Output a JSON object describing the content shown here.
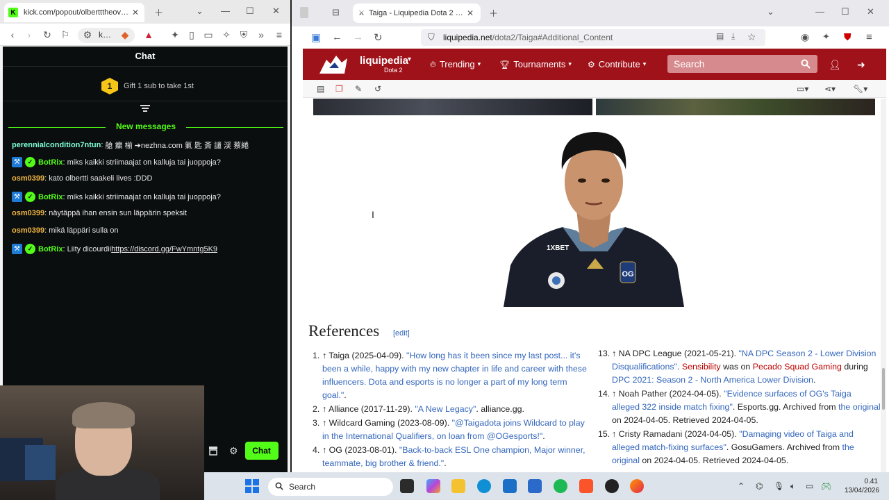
{
  "left_browser": {
    "tab_title": "kick.com/popout/olbertttheovers",
    "url_short": "k…",
    "chat": {
      "title": "Chat",
      "gift_number": "1",
      "gift_text": "Gift 1 sub to take 1st",
      "new_messages_label": "New messages",
      "messages": [
        {
          "user": "perennialcondition7ntun",
          "text": "艙 瘺 椾 ➔nezhna.com 氭 匙 斎 譴 渓 蔡綣",
          "color": "#7fffd4",
          "badges": []
        },
        {
          "user": "BotRix",
          "text": "miks kaikki striimaajat on kalluja tai juoppoja?",
          "color": "#53fc18",
          "badges": [
            "mod",
            "verified"
          ]
        },
        {
          "user": "osm0399",
          "text": "kato olbertti saakeli lives :DDD",
          "color": "#f0b642",
          "badges": []
        },
        {
          "user": "BotRix",
          "text": "miks kaikki striimaajat on kalluja tai juoppoja?",
          "color": "#53fc18",
          "badges": [
            "mod",
            "verified"
          ]
        },
        {
          "user": "osm0399",
          "text": "näytäppä ihan ensin sun läppärin speksit",
          "color": "#f0b642",
          "badges": []
        },
        {
          "user": "osm0399",
          "text": "mikä läppäri sulla on",
          "color": "#f0b642",
          "badges": []
        },
        {
          "user": "BotRix",
          "text": "Liity dicourdii ",
          "link": "https://discord.gg/FwYmntg5K9",
          "color": "#53fc18",
          "badges": [
            "mod",
            "verified"
          ]
        }
      ],
      "send_label": "Chat"
    }
  },
  "right_browser": {
    "tab_title": "Taiga - Liquipedia Dota 2 Wiki",
    "url_host": "liquipedia.net",
    "url_rest": "/dota2/Taiga#Additional_Content",
    "nav": {
      "brand": "liquipedia",
      "sub": "Dota 2",
      "menu": [
        "Trending",
        "Tournaments",
        "Contribute"
      ],
      "search_placeholder": "Search"
    },
    "references_heading": "References",
    "edit_label": "[edit]",
    "references_left": [
      {
        "n": "1.",
        "parts": [
          {
            "t": "↑ Taiga (2025-04-09). "
          },
          {
            "t": "\"How long has it been since my last post... it's been a while, happy with my new chapter in life and career with these influencers. Dota and esports is no longer a part of my long term goal.\"",
            "link": true
          },
          {
            "t": "."
          }
        ]
      },
      {
        "n": "2.",
        "parts": [
          {
            "t": "↑ Alliance (2017-11-29). "
          },
          {
            "t": "\"A New Legacy\"",
            "link": true
          },
          {
            "t": ". alliance.gg."
          }
        ]
      },
      {
        "n": "3.",
        "parts": [
          {
            "t": "↑ Wildcard Gaming (2023-08-09). "
          },
          {
            "t": "\"@Taigadota joins Wildcard to play in the International Qualifiers, on loan from @OGesports!\"",
            "link": true
          },
          {
            "t": "."
          }
        ]
      },
      {
        "n": "4.",
        "parts": [
          {
            "t": "↑ OG (2023-08-01). "
          },
          {
            "t": "\"Back-to-back ESL One champion, Major winner, teammate, big brother & friend.\"",
            "link": true
          },
          {
            "t": "."
          }
        ]
      }
    ],
    "references_right": [
      {
        "n": "13.",
        "parts": [
          {
            "t": "↑ NA DPC League (2021-05-21). "
          },
          {
            "t": "\"NA DPC Season 2 - Lower Division Disqualifications\"",
            "link": true
          },
          {
            "t": ". "
          },
          {
            "t": "Sensibility",
            "red": true
          },
          {
            "t": " was on "
          },
          {
            "t": "Pecado Squad Gaming",
            "red": true
          },
          {
            "t": " during "
          },
          {
            "t": "DPC 2021: Season 2 - North America Lower Division",
            "link": true
          },
          {
            "t": "."
          }
        ]
      },
      {
        "n": "14.",
        "parts": [
          {
            "t": "↑ Noah Pather (2024-04-05). "
          },
          {
            "t": "\"Evidence surfaces of OG's Taiga alleged 322 inside match fixing\"",
            "link": true
          },
          {
            "t": ". Esports.gg. Archived from "
          },
          {
            "t": "the original",
            "link": true
          },
          {
            "t": " on 2024-04-05. Retrieved 2024-04-05."
          }
        ]
      },
      {
        "n": "15.",
        "parts": [
          {
            "t": "↑ Cristy Ramadani (2024-04-05). "
          },
          {
            "t": "\"Damaging video of Taiga and alleged match-fixing surfaces\"",
            "link": true
          },
          {
            "t": ". GosuGamers. Archived from "
          },
          {
            "t": "the original",
            "link": true
          },
          {
            "t": " on 2024-04-05. Retrieved 2024-04-05."
          }
        ]
      }
    ]
  },
  "taskbar": {
    "search_placeholder": "Search",
    "time": "0.41",
    "date": "13/04/2026"
  }
}
